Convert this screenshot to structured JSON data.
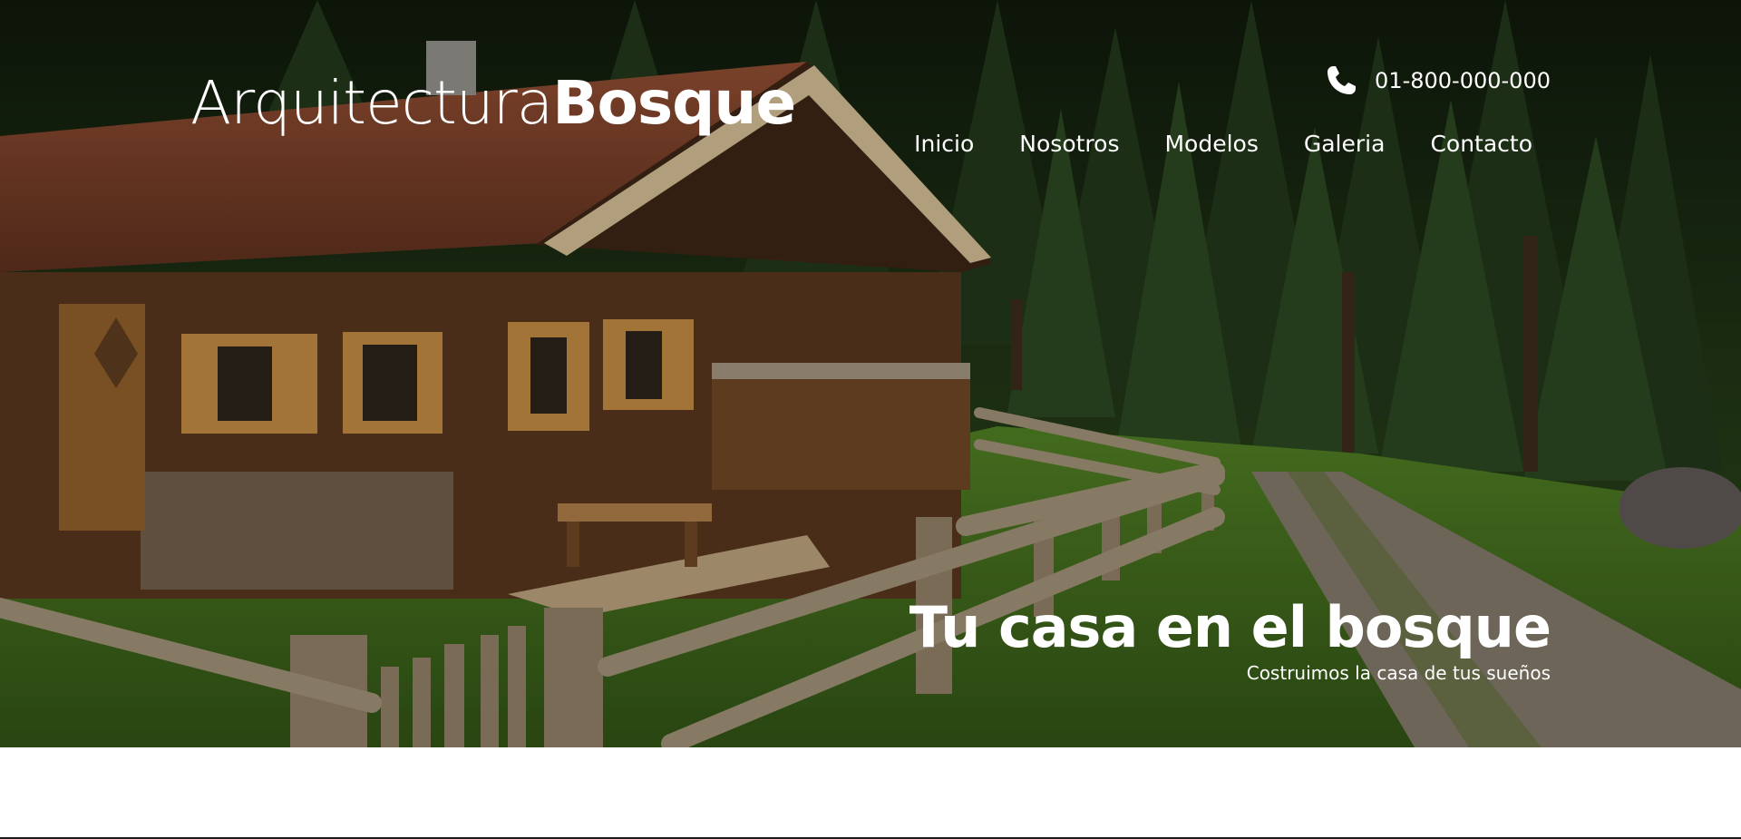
{
  "header": {
    "logo_light": "Arquitectura",
    "logo_bold": "Bosque",
    "phone_icon": "phone-icon",
    "phone_number": "01-800-000-000"
  },
  "nav": {
    "items": [
      {
        "label": "Inicio"
      },
      {
        "label": "Nosotros"
      },
      {
        "label": "Modelos"
      },
      {
        "label": "Galeria"
      },
      {
        "label": "Contacto"
      }
    ]
  },
  "hero": {
    "title": "Tu casa en el bosque",
    "subtitle": "Costruimos la casa de tus sueños"
  },
  "colors": {
    "text": "#ffffff",
    "forest_dark": "#16240f",
    "grass": "#3f6b1f",
    "roof": "#6e3b27",
    "wood": "#6a4424"
  }
}
